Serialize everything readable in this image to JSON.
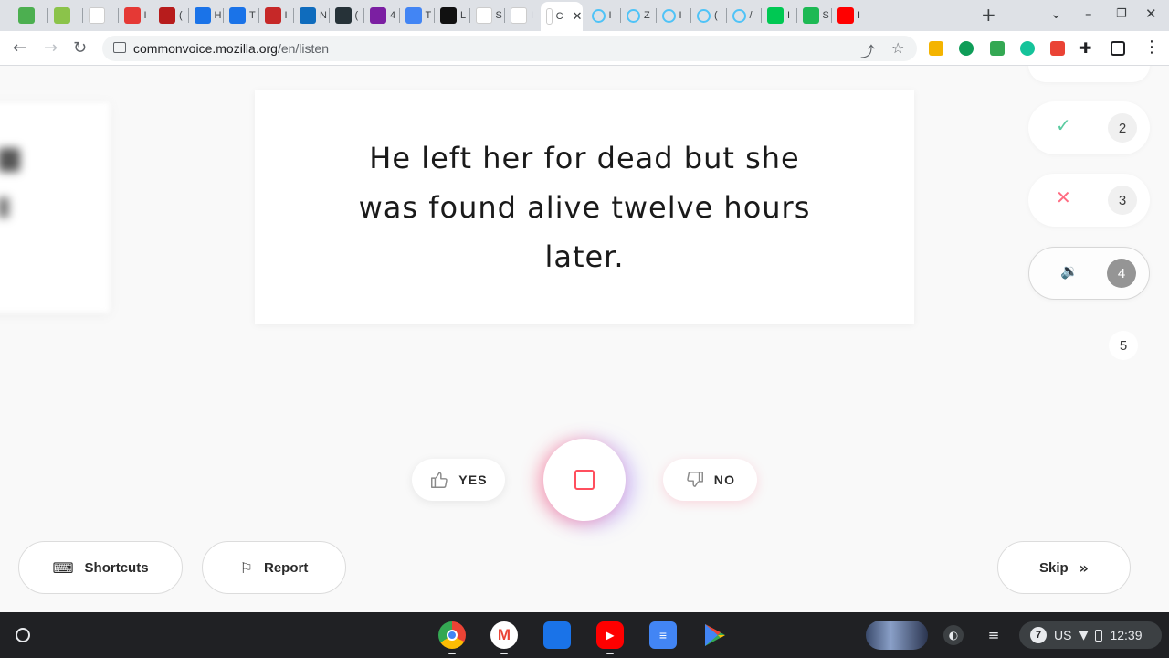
{
  "browser": {
    "tabs": [
      {
        "icon": "windows-logo-icon",
        "label": "",
        "color": "#4caf50"
      },
      {
        "icon": "checker-app-icon",
        "label": "",
        "color": "#8bc34a"
      },
      {
        "icon": "calendar-grid-icon",
        "label": "",
        "color": "#ffffff"
      },
      {
        "icon": "100plus-icon",
        "label": "I",
        "color": "#e53935"
      },
      {
        "icon": "cops-icon",
        "label": "(",
        "color": "#b71c1c"
      },
      {
        "icon": "c-circle-icon",
        "label": "H",
        "color": "#1a73e8"
      },
      {
        "icon": "c-circle-icon",
        "label": "T",
        "color": "#1a73e8"
      },
      {
        "icon": "letter-a-icon",
        "label": "I",
        "color": "#c62828"
      },
      {
        "icon": "outlook-icon",
        "label": "N",
        "color": "#0f6cbd"
      },
      {
        "icon": "sis-icon",
        "label": "(",
        "color": "#263238"
      },
      {
        "icon": "contact-icon",
        "label": "4",
        "color": "#7b1fa2"
      },
      {
        "icon": "docs-icon",
        "label": "T",
        "color": "#4285f4"
      },
      {
        "icon": "d2l-icon",
        "label": "L",
        "color": "#111111"
      },
      {
        "icon": "google-icon",
        "label": "S",
        "color": "#ffffff"
      },
      {
        "icon": "mozilla-icon",
        "label": "I",
        "color": "#ffffff"
      },
      {
        "icon": "common-voice-icon",
        "label": "C",
        "color": "#ffffff",
        "active": true
      },
      {
        "icon": "loading-icon",
        "label": "I",
        "color": "#4fc3f7"
      },
      {
        "icon": "loading-icon",
        "label": "Z",
        "color": "#4fc3f7"
      },
      {
        "icon": "loading-icon",
        "label": "I",
        "color": "#4fc3f7"
      },
      {
        "icon": "loading-icon",
        "label": "(",
        "color": "#4fc3f7"
      },
      {
        "icon": "loading-icon",
        "label": "/",
        "color": "#4fc3f7"
      },
      {
        "icon": "green-app-icon",
        "label": "I",
        "color": "#00c853"
      },
      {
        "icon": "spotify-icon",
        "label": "S",
        "color": "#1db954"
      },
      {
        "icon": "youtube-icon",
        "label": "I",
        "color": "#ff0000"
      }
    ],
    "new_tab": "+",
    "url_host": "commonvoice.mozilla.org",
    "url_path": "/en/listen"
  },
  "sentence": "He left her for dead but she was found alive twelve hours later.",
  "clips": [
    {
      "number": "2",
      "status": "accepted",
      "icon": "check-icon",
      "glyph": "✓",
      "color": "#59cba0"
    },
    {
      "number": "3",
      "status": "rejected",
      "icon": "x-icon",
      "glyph": "✕",
      "color": "#ff6b81"
    },
    {
      "number": "4",
      "status": "playing",
      "icon": "speaker-icon",
      "glyph": "🔉",
      "color": "#b0b0b0"
    },
    {
      "number": "5",
      "status": "pending"
    }
  ],
  "controls": {
    "yes_label": "YES",
    "no_label": "NO"
  },
  "footer": {
    "shortcuts_label": "Shortcuts",
    "report_label": "Report",
    "skip_label": "Skip"
  },
  "shelf": {
    "apps": [
      "chrome-icon",
      "gmail-icon",
      "files-icon",
      "youtube-icon",
      "docs-icon",
      "play-store-icon"
    ],
    "notification_count": "7",
    "keyboard_layout": "US",
    "time": "12:39"
  }
}
